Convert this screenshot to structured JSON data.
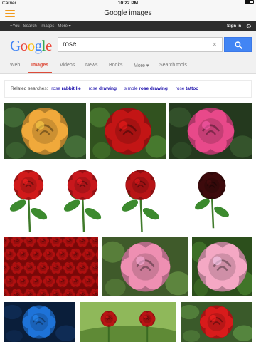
{
  "status_bar": {
    "carrier": "Carrier",
    "time": "10:22 PM",
    "battery_level": 0.55
  },
  "app_bar": {
    "title": "Google images",
    "menu_icon": "hamburger-menu-icon"
  },
  "google_bar": {
    "links": [
      "+You",
      "Search",
      "Images",
      "More ▾"
    ],
    "active_link_index": 2,
    "sign_in": "Sign in",
    "settings_icon": "gear-icon"
  },
  "search": {
    "logo": {
      "letters": [
        "G",
        "o",
        "o",
        "g",
        "l",
        "e"
      ]
    },
    "query": "rose",
    "clear_icon": "clear-x-icon",
    "button_icon": "magnifier-icon",
    "accent": "#4285f4"
  },
  "tabs": {
    "items": [
      "Web",
      "Images",
      "Videos",
      "News",
      "Books",
      "More ▾",
      "Search tools"
    ],
    "active_index": 1,
    "active_color": "#dd4b39"
  },
  "related": {
    "label": "Related searches:",
    "items": [
      {
        "prefix": "rose",
        "bold": "rabbit lie"
      },
      {
        "prefix": "rose",
        "bold": "drawing"
      },
      {
        "prefix": "simple",
        "bold": "rose drawing"
      },
      {
        "prefix": "rose",
        "bold": "tattoo"
      }
    ]
  },
  "results": [
    {
      "subject": "yellow rose",
      "color": "#f0a93b"
    },
    {
      "subject": "red rose",
      "color": "#c31515"
    },
    {
      "subject": "pink rose",
      "color": "#e8498a"
    },
    {
      "subject": "single red rose",
      "color": "#d11a1a"
    },
    {
      "subject": "red rose stem",
      "color": "#c8171c"
    },
    {
      "subject": "red rose bud",
      "color": "#b81416"
    },
    {
      "subject": "dark red rose",
      "color": "#3d0a0c"
    },
    {
      "subject": "red roses field",
      "color": "#b01010"
    },
    {
      "subject": "pink rose",
      "color": "#ee8fb2"
    },
    {
      "subject": "light pink rose",
      "color": "#f4a8c4"
    },
    {
      "subject": "blue rose",
      "color": "#1e73d8"
    },
    {
      "subject": "red roses garden",
      "color": "#b81414"
    },
    {
      "subject": "red rose bloom",
      "color": "#d81b1b"
    }
  ]
}
